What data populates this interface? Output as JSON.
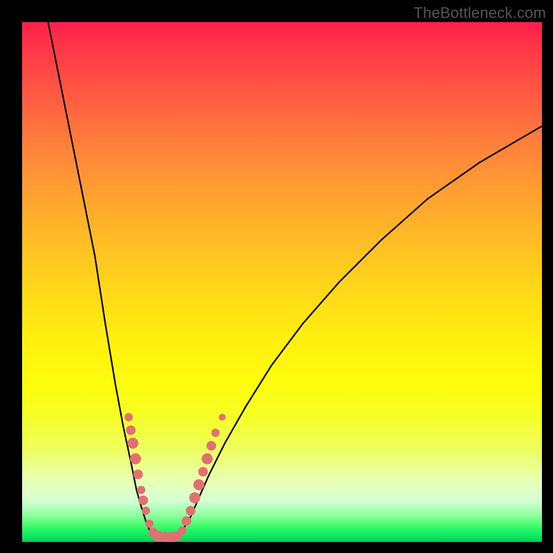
{
  "watermark": "TheBottleneck.com",
  "chart_data": {
    "type": "line",
    "title": "",
    "xlabel": "",
    "ylabel": "",
    "xlim": [
      0,
      100
    ],
    "ylim": [
      0,
      100
    ],
    "grid": false,
    "legend": false,
    "background": "gradient-red-to-green-vertical",
    "series": [
      {
        "name": "left-branch",
        "x": [
          5,
          8,
          11,
          14,
          16,
          18,
          19.5,
          21,
          22,
          23,
          23.8,
          24.4,
          25,
          25.5
        ],
        "values": [
          100,
          85,
          70,
          55,
          42,
          30,
          22,
          15,
          10,
          6.5,
          4,
          2.5,
          1.5,
          1
        ]
      },
      {
        "name": "valley-floor",
        "x": [
          25.5,
          27,
          28.5,
          30
        ],
        "values": [
          1,
          0.8,
          0.8,
          1
        ]
      },
      {
        "name": "right-branch",
        "x": [
          30,
          31,
          32.5,
          34,
          36,
          39,
          43,
          48,
          54,
          61,
          69,
          78,
          88,
          100
        ],
        "values": [
          1,
          2.5,
          5,
          8.5,
          13,
          19,
          26,
          34,
          42,
          50,
          58,
          66,
          73,
          80
        ]
      }
    ],
    "markers": [
      {
        "x": 20.5,
        "y": 24,
        "r": 6
      },
      {
        "x": 20.9,
        "y": 21.5,
        "r": 7
      },
      {
        "x": 21.3,
        "y": 19,
        "r": 8
      },
      {
        "x": 21.8,
        "y": 16,
        "r": 8
      },
      {
        "x": 22.3,
        "y": 13,
        "r": 7
      },
      {
        "x": 22.9,
        "y": 10,
        "r": 6
      },
      {
        "x": 23.3,
        "y": 8,
        "r": 7
      },
      {
        "x": 23.8,
        "y": 6,
        "r": 6
      },
      {
        "x": 24.5,
        "y": 3.5,
        "r": 6
      },
      {
        "x": 25.2,
        "y": 1.8,
        "r": 7
      },
      {
        "x": 26.2,
        "y": 1.1,
        "r": 8
      },
      {
        "x": 27.5,
        "y": 0.9,
        "r": 8
      },
      {
        "x": 28.8,
        "y": 0.9,
        "r": 8
      },
      {
        "x": 29.8,
        "y": 1.1,
        "r": 7
      },
      {
        "x": 30.8,
        "y": 2.2,
        "r": 6
      },
      {
        "x": 31.6,
        "y": 4,
        "r": 7
      },
      {
        "x": 32.4,
        "y": 6,
        "r": 7
      },
      {
        "x": 33.2,
        "y": 8.5,
        "r": 8
      },
      {
        "x": 34,
        "y": 11,
        "r": 8
      },
      {
        "x": 34.8,
        "y": 13.5,
        "r": 7
      },
      {
        "x": 35.6,
        "y": 16,
        "r": 8
      },
      {
        "x": 36.4,
        "y": 18.5,
        "r": 7
      },
      {
        "x": 37.2,
        "y": 21,
        "r": 6
      },
      {
        "x": 38.5,
        "y": 24,
        "r": 5
      }
    ]
  }
}
